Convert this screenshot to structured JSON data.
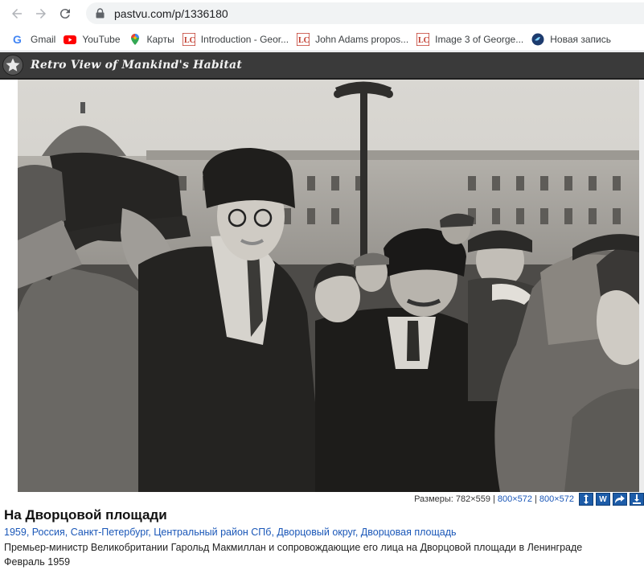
{
  "browser": {
    "url": "pastvu.com/p/1336180",
    "bookmarks": [
      {
        "label": "Gmail",
        "icon": "gmail-icon"
      },
      {
        "label": "YouTube",
        "icon": "youtube-icon"
      },
      {
        "label": "Карты",
        "icon": "maps-icon"
      },
      {
        "label": "Introduction - Geor...",
        "icon": "loc-icon"
      },
      {
        "label": "John Adams propos...",
        "icon": "loc-icon"
      },
      {
        "label": "Image 3 of George...",
        "icon": "loc-icon"
      },
      {
        "label": "Новая запись",
        "icon": "bird-icon"
      }
    ]
  },
  "site": {
    "title": "Retro View of Mankind's Habitat"
  },
  "photo": {
    "sizes_label": "Размеры:",
    "size_current": "782×559",
    "size_link_1": "800×572",
    "size_link_2": "800×572",
    "separator": "|",
    "tool_w_label": "W"
  },
  "caption": {
    "title": "На Дворцовой площади",
    "breadcrumbs": [
      "1959",
      "Россия",
      "Санкт-Петербург",
      "Центральный район СПб",
      "Дворцовый округ",
      "Дворцовая площадь"
    ],
    "description": "Премьер-министр Великобритании Гарольд Макмиллан и сопровождающие его лица на Дворцовой площади в Ленинграде",
    "date": "Февраль 1959"
  },
  "colors": {
    "header_bg": "#3a3a3a",
    "link": "#1a57b8",
    "tool_button": "#1d5ca8"
  }
}
